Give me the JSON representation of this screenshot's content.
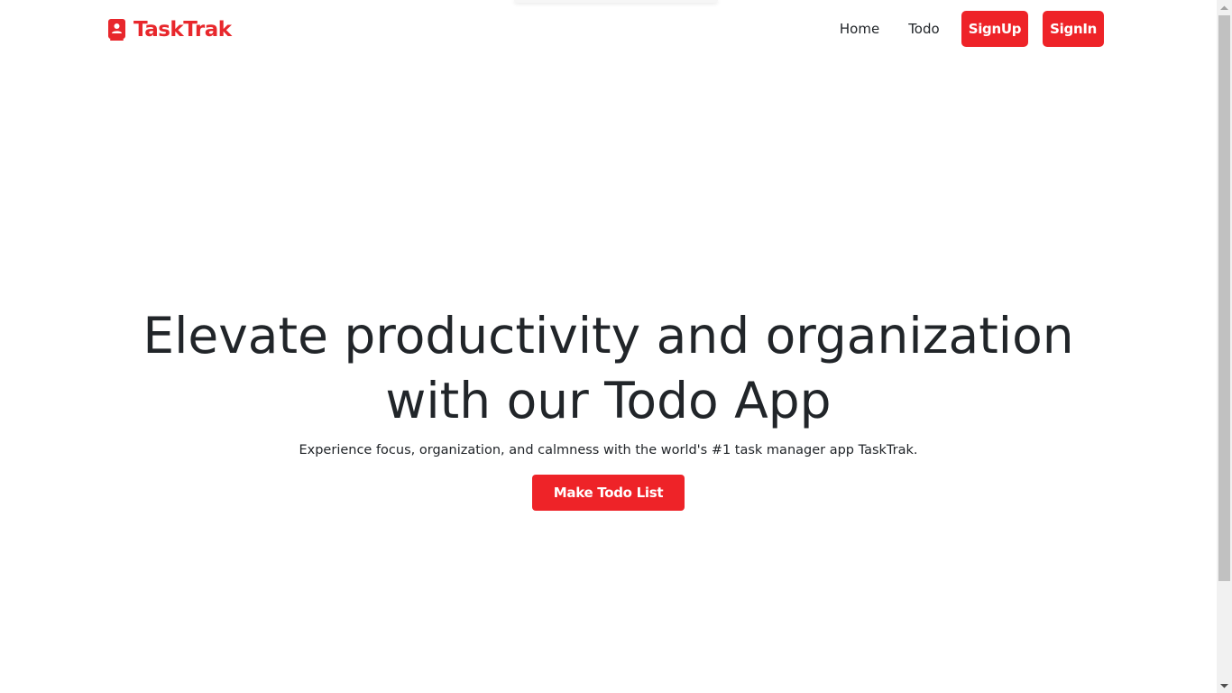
{
  "brand": {
    "name": "TaskTrak",
    "icon": "contact-book-icon",
    "color": "#e8272c"
  },
  "nav": {
    "home": "Home",
    "todo": "Todo",
    "signup": "SignUp",
    "signin": "SignIn"
  },
  "hero": {
    "title": "Elevate productivity and organization with our Todo App",
    "subtitle": "Experience focus, organization, and calmness with the world's #1 task manager app TaskTrak.",
    "cta": "Make Todo List"
  },
  "theme": {
    "accent": "#ee2328",
    "text": "#212529",
    "background": "#ffffff"
  }
}
